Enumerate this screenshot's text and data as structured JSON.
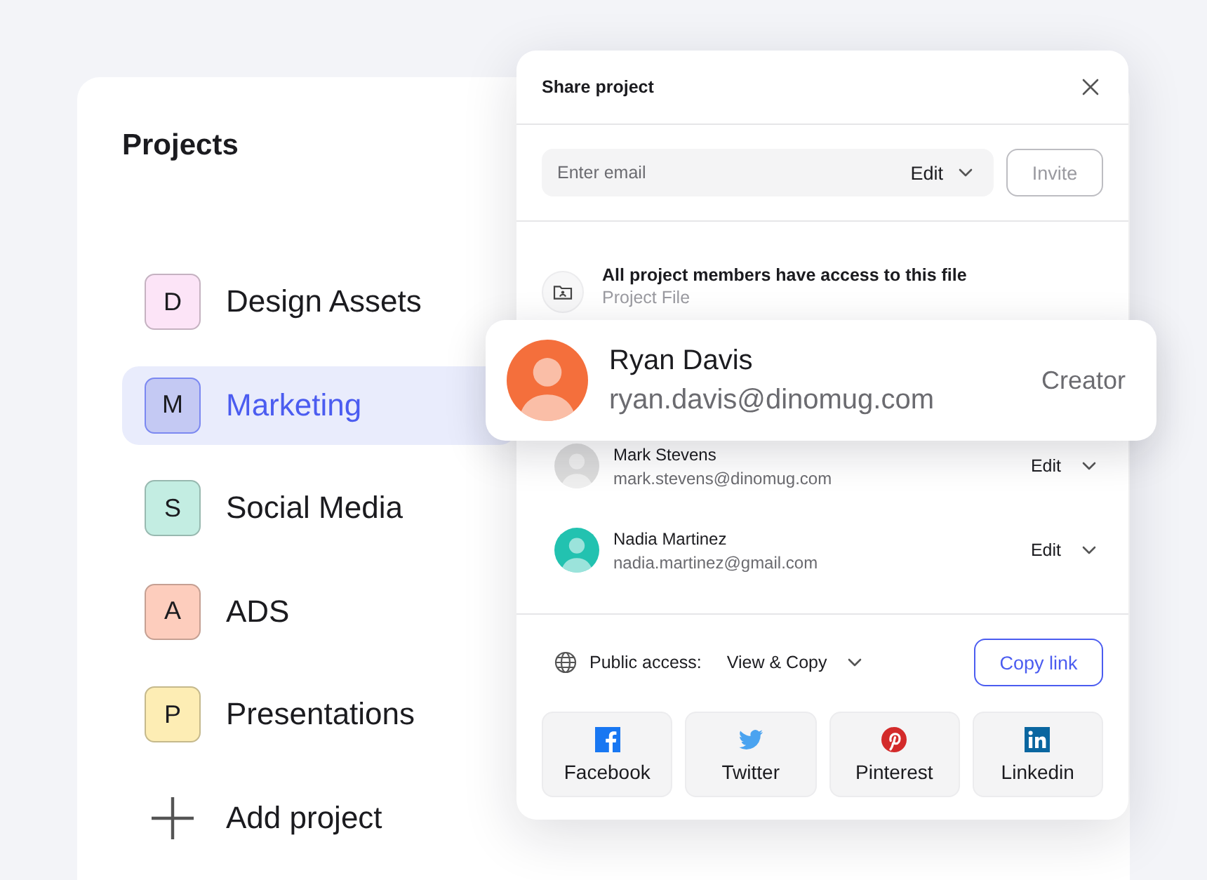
{
  "projects": {
    "title": "Projects",
    "items": [
      {
        "letter": "D",
        "name": "Design Assets",
        "color": "#fce4f7",
        "selected": false
      },
      {
        "letter": "M",
        "name": "Marketing",
        "color": "#c4c9f3",
        "selected": true
      },
      {
        "letter": "S",
        "name": "Social Media",
        "color": "#c3ede2",
        "selected": false
      },
      {
        "letter": "A",
        "name": "ADS",
        "color": "#fdcdbd",
        "selected": false
      },
      {
        "letter": "P",
        "name": "Presentations",
        "color": "#fdedb4",
        "selected": false
      }
    ],
    "add_label": "Add project"
  },
  "share_dialog": {
    "title": "Share project",
    "invite": {
      "placeholder": "Enter email",
      "permission": "Edit",
      "button": "Invite",
      "disabled": true
    },
    "file_access": {
      "title": "All project members have access to this file",
      "subtitle": "Project File"
    },
    "members": [
      {
        "name": "Mark Stevens",
        "email": "mark.stevens@dinomug.com",
        "role": "Edit",
        "color": "#dcdcdc"
      },
      {
        "name": "Nadia Martinez",
        "email": "nadia.martinez@gmail.com",
        "role": "Edit",
        "color": "#22c2b0"
      }
    ],
    "public_access": {
      "label": "Public access:",
      "value": "View & Copy",
      "button": "Copy link"
    },
    "share_buttons": [
      {
        "kind": "facebook",
        "label": "Facebook"
      },
      {
        "kind": "twitter",
        "label": "Twitter"
      },
      {
        "kind": "pinterest",
        "label": "Pinterest"
      },
      {
        "kind": "linkedin",
        "label": "Linkedin"
      }
    ]
  },
  "owner_card": {
    "name": "Ryan Davis",
    "email": "ryan.davis@dinomug.com",
    "role": "Creator",
    "color": "#f46f3c"
  }
}
